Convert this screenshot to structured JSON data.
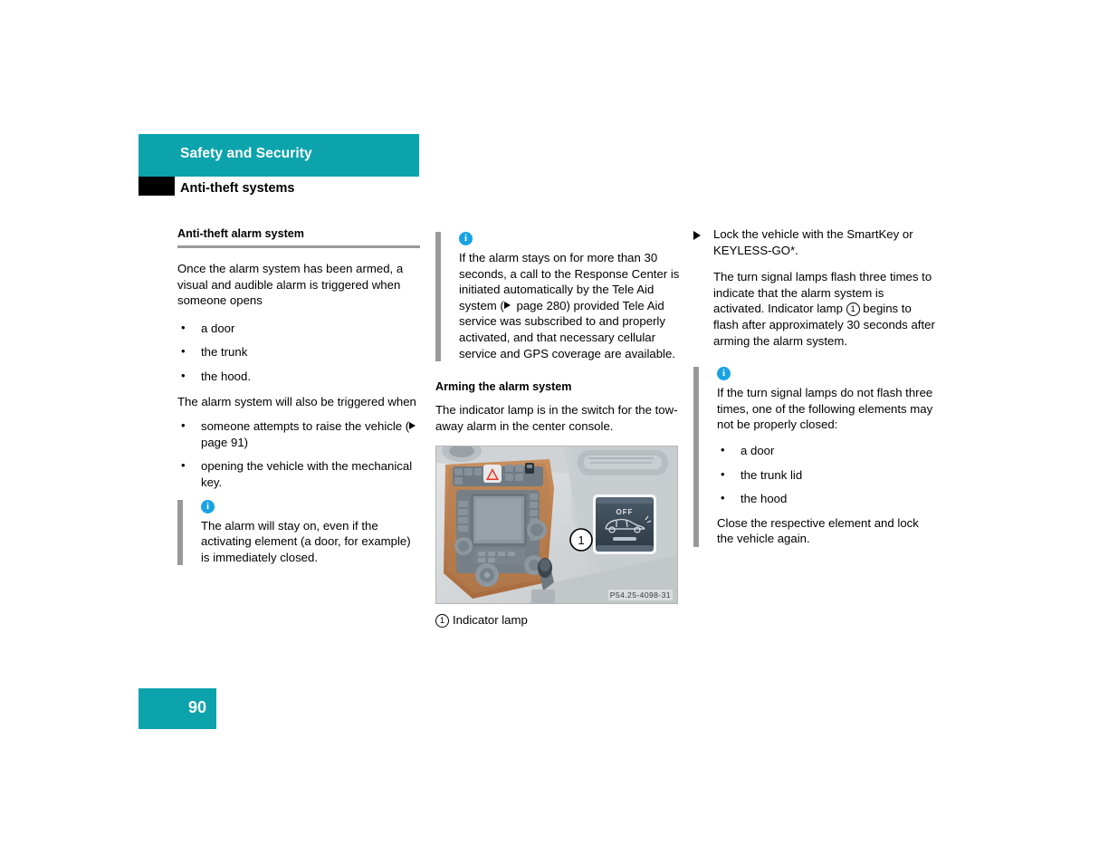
{
  "header": {
    "band_title": "Safety and Security",
    "subtitle": "Anti-theft systems",
    "band_color": "#0ca3ac"
  },
  "footer": {
    "page_number": "90",
    "box_color": "#0ca3ac"
  },
  "colors": {
    "teal": "#0ca3ac",
    "info_blue": "#19a3e5",
    "rule_gray": "#999999"
  },
  "column1": {
    "heading": "Anti-theft alarm system",
    "intro": "Once the alarm system has been armed, a visual and audible alarm is triggered when someone opens",
    "list1": [
      "a door",
      "the trunk",
      "the hood."
    ],
    "paragraph2": "The alarm system will also be triggered when",
    "list2_item1_pre": "someone attempts to raise the vehicle (",
    "list2_item1_post": " page 91)",
    "list2_item2": "opening the vehicle with the mechanical key.",
    "note": {
      "icon": "info-icon",
      "text": "The alarm will stay on, even if the activating element (a door, for example) is immediately closed."
    }
  },
  "column2": {
    "note": {
      "icon": "info-icon",
      "text_pre": "If the alarm stays on for more than 30 seconds, a call to the Response Center is initiated automatically by the Tele Aid system (",
      "text_post": " page 280) provided Tele Aid service was subscribed to and properly activated, and that necessary cellular service and GPS coverage are available."
    },
    "heading": "Arming the alarm system",
    "paragraph": "The indicator lamp is in the switch for the tow-away alarm in the center console.",
    "figure": {
      "alt": "Center console with tow-away alarm switch",
      "switch_label": "OFF",
      "callout_number": "1",
      "code": "P54.25-4098-31"
    },
    "caption_number": "1",
    "caption_text": "Indicator lamp"
  },
  "column3": {
    "step1": "Lock the vehicle with the SmartKey or KEYLESS-GO*.",
    "paragraph_pre": "The turn signal lamps flash three times to indicate that the alarm system is activated. Indicator lamp ",
    "paragraph_circled": "1",
    "paragraph_post": " begins to flash after approximately 30 seconds after arming the alarm system.",
    "note": {
      "icon": "info-icon",
      "text": "If the turn signal lamps do not flash three times, one of the following elements may not be properly closed:",
      "list": [
        "a door",
        "the trunk lid",
        "the hood"
      ],
      "closing": "Close the respective element and lock the vehicle again."
    }
  }
}
